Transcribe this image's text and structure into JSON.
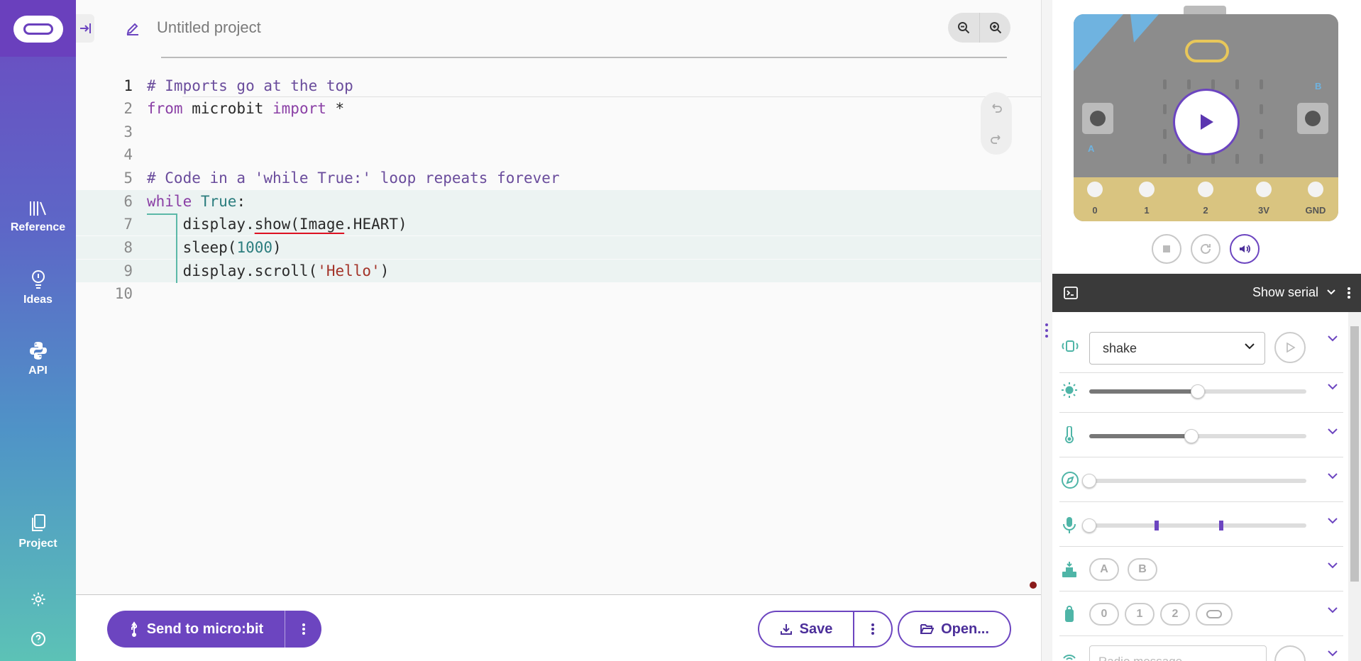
{
  "nav": {
    "items": [
      {
        "label": "Reference",
        "icon": "library-icon"
      },
      {
        "label": "Ideas",
        "icon": "lightbulb-icon"
      },
      {
        "label": "API",
        "icon": "python-icon"
      },
      {
        "label": "Project",
        "icon": "files-icon"
      }
    ]
  },
  "header": {
    "project_name": "Untitled project"
  },
  "editor": {
    "lines": [
      {
        "num": "1",
        "tokens": [
          [
            "c-cm",
            "# Imports go at the top"
          ]
        ]
      },
      {
        "num": "2",
        "tokens": [
          [
            "c-kw",
            "from"
          ],
          [
            "c-id",
            " microbit "
          ],
          [
            "c-kw",
            "import"
          ],
          [
            "c-id",
            " *"
          ]
        ]
      },
      {
        "num": "3",
        "tokens": []
      },
      {
        "num": "4",
        "tokens": []
      },
      {
        "num": "5",
        "tokens": [
          [
            "c-cm",
            "# Code in a 'while True:' loop repeats forever"
          ]
        ]
      },
      {
        "num": "6",
        "tokens": [
          [
            "c-kw",
            "while"
          ],
          [
            "c-id",
            " "
          ],
          [
            "c-num",
            "True"
          ],
          [
            "c-id",
            ":"
          ]
        ]
      },
      {
        "num": "7",
        "tokens": [
          [
            "c-id",
            "    display."
          ],
          [
            "c-id squig",
            "show(Image"
          ],
          [
            "c-id",
            ".HEART)"
          ]
        ]
      },
      {
        "num": "8",
        "tokens": [
          [
            "c-id",
            "    sleep("
          ],
          [
            "c-num",
            "1000"
          ],
          [
            "c-id",
            ")"
          ]
        ]
      },
      {
        "num": "9",
        "tokens": [
          [
            "c-id",
            "    display.scroll("
          ],
          [
            "c-str",
            "'Hello'"
          ],
          [
            "c-id",
            ")"
          ]
        ]
      },
      {
        "num": "10",
        "tokens": []
      }
    ]
  },
  "toolbar": {
    "send_label": "Send to micro:bit",
    "save_label": "Save",
    "open_label": "Open..."
  },
  "simulator": {
    "pins": [
      "0",
      "1",
      "2",
      "3V",
      "GND"
    ],
    "button_a": "A",
    "button_b": "B",
    "serial_label": "Show serial",
    "gesture_value": "shake",
    "light_level": 0.5,
    "temperature_level": 0.47,
    "compass_level": 0,
    "sound_level": 0,
    "buttons": [
      "A",
      "B"
    ],
    "touch_pins": [
      "0",
      "1",
      "2"
    ],
    "radio_placeholder": "Radio message"
  },
  "colors": {
    "brand": "#6c45c0",
    "sensor_icon": "#4fb5a7"
  }
}
